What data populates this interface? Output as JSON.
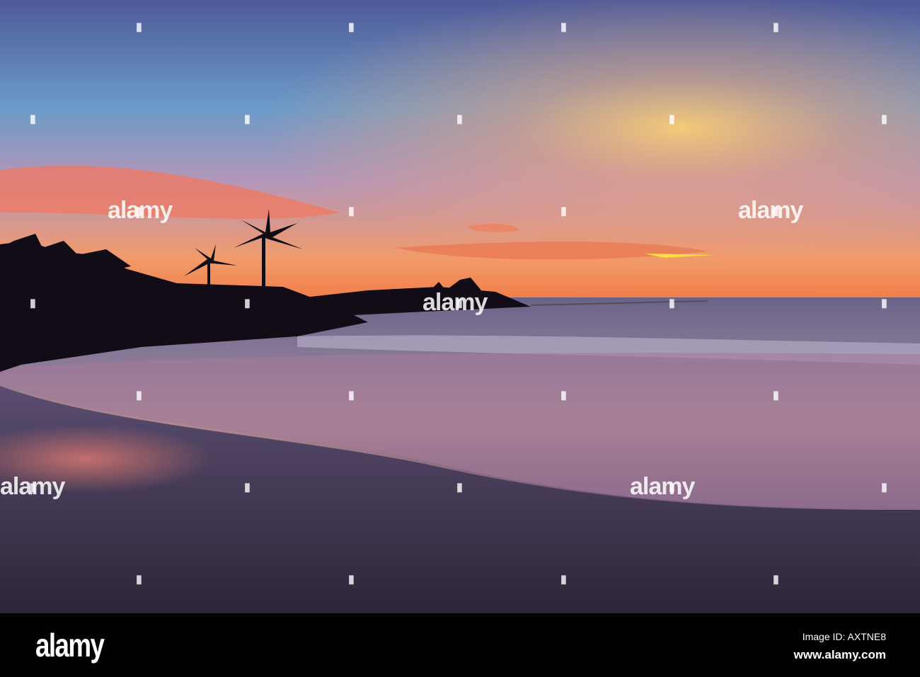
{
  "photo": {
    "subject": "sunset-beach-photo"
  },
  "watermark": {
    "text": "alamy"
  },
  "footer": {
    "logo": "alamy",
    "image_id": "Image ID: AXTNE8",
    "url": "www.alamy.com"
  },
  "colors": {
    "sky_top": "#5a6a9e",
    "sky_mid": "#6a9cc8",
    "horizon": "#f08a50",
    "sand": "#3a2f45"
  }
}
